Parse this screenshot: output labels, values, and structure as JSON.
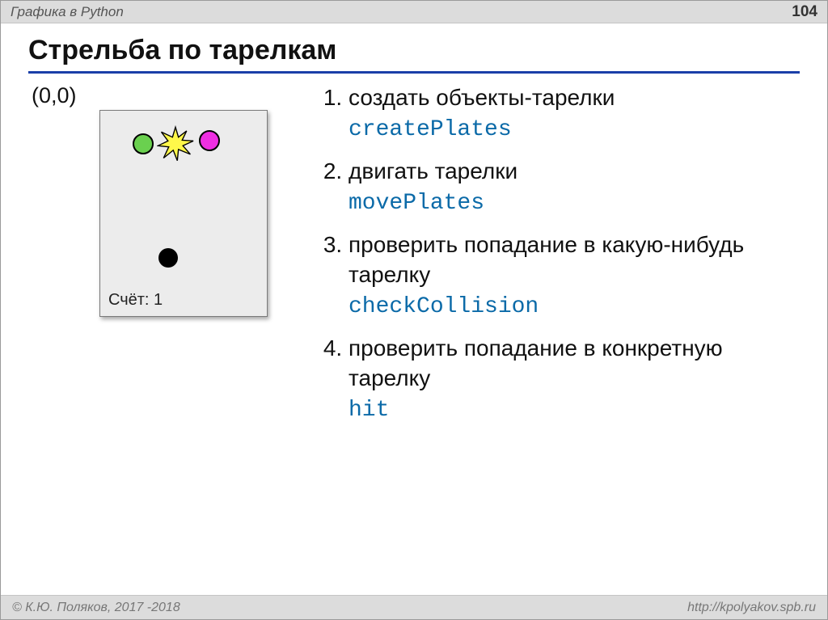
{
  "header": {
    "category": "Графика в Python",
    "page": "104"
  },
  "title": "Стрельба по тарелкам",
  "origin": "(0,0)",
  "score_label": "Счёт: 1",
  "steps": [
    {
      "text": "создать объекты-тарелки",
      "code": "createPlates"
    },
    {
      "text": "двигать тарелки",
      "code": "movePlates"
    },
    {
      "text": "проверить попадание в какую-нибудь тарелку",
      "code": "checkCollision"
    },
    {
      "text": "проверить попадание в конкретную тарелку",
      "code": "hit"
    }
  ],
  "footer": {
    "left": "© К.Ю. Поляков, 2017 -2018",
    "right": "http://kpolyakov.spb.ru"
  }
}
